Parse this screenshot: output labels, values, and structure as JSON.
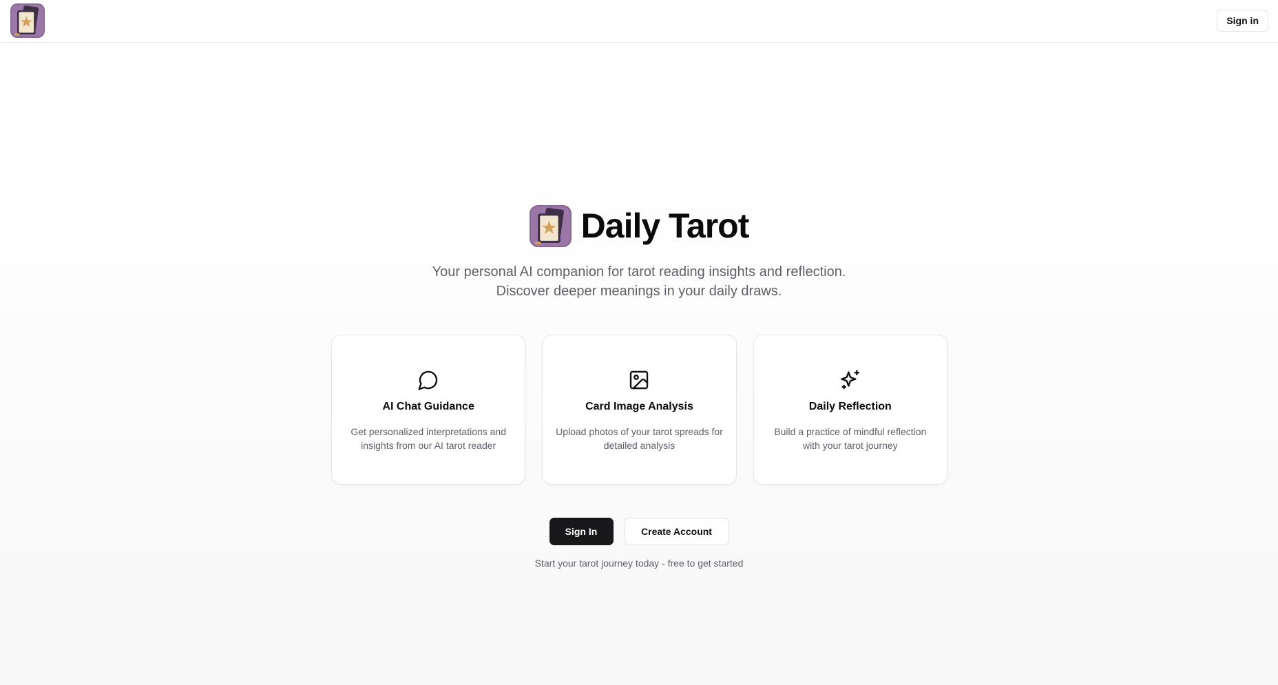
{
  "header": {
    "logo_icon": "tarot-card-logo-icon",
    "signin_label": "Sign in"
  },
  "hero": {
    "logo_icon": "tarot-card-logo-icon",
    "title": "Daily Tarot",
    "subtitle_line1": "Your personal AI companion for tarot reading insights and reflection.",
    "subtitle_line2": "Discover deeper meanings in your daily draws."
  },
  "features": [
    {
      "icon": "chat-bubble-icon",
      "title": "AI Chat Guidance",
      "description": "Get personalized interpretations and insights from our AI tarot reader"
    },
    {
      "icon": "image-icon",
      "title": "Card Image Analysis",
      "description": "Upload photos of your tarot spreads for detailed analysis"
    },
    {
      "icon": "sparkles-icon",
      "title": "Daily Reflection",
      "description": "Build a practice of mindful reflection with your tarot journey"
    }
  ],
  "cta": {
    "signin_label": "Sign In",
    "create_account_label": "Create Account",
    "footnote": "Start your tarot journey today - free to get started"
  },
  "colors": {
    "logo_bg": "#8a6797",
    "logo_card": "#f3e6cf",
    "logo_star": "#d4a05a",
    "primary_button": "#18181b",
    "muted_text": "#5f5f6a"
  }
}
